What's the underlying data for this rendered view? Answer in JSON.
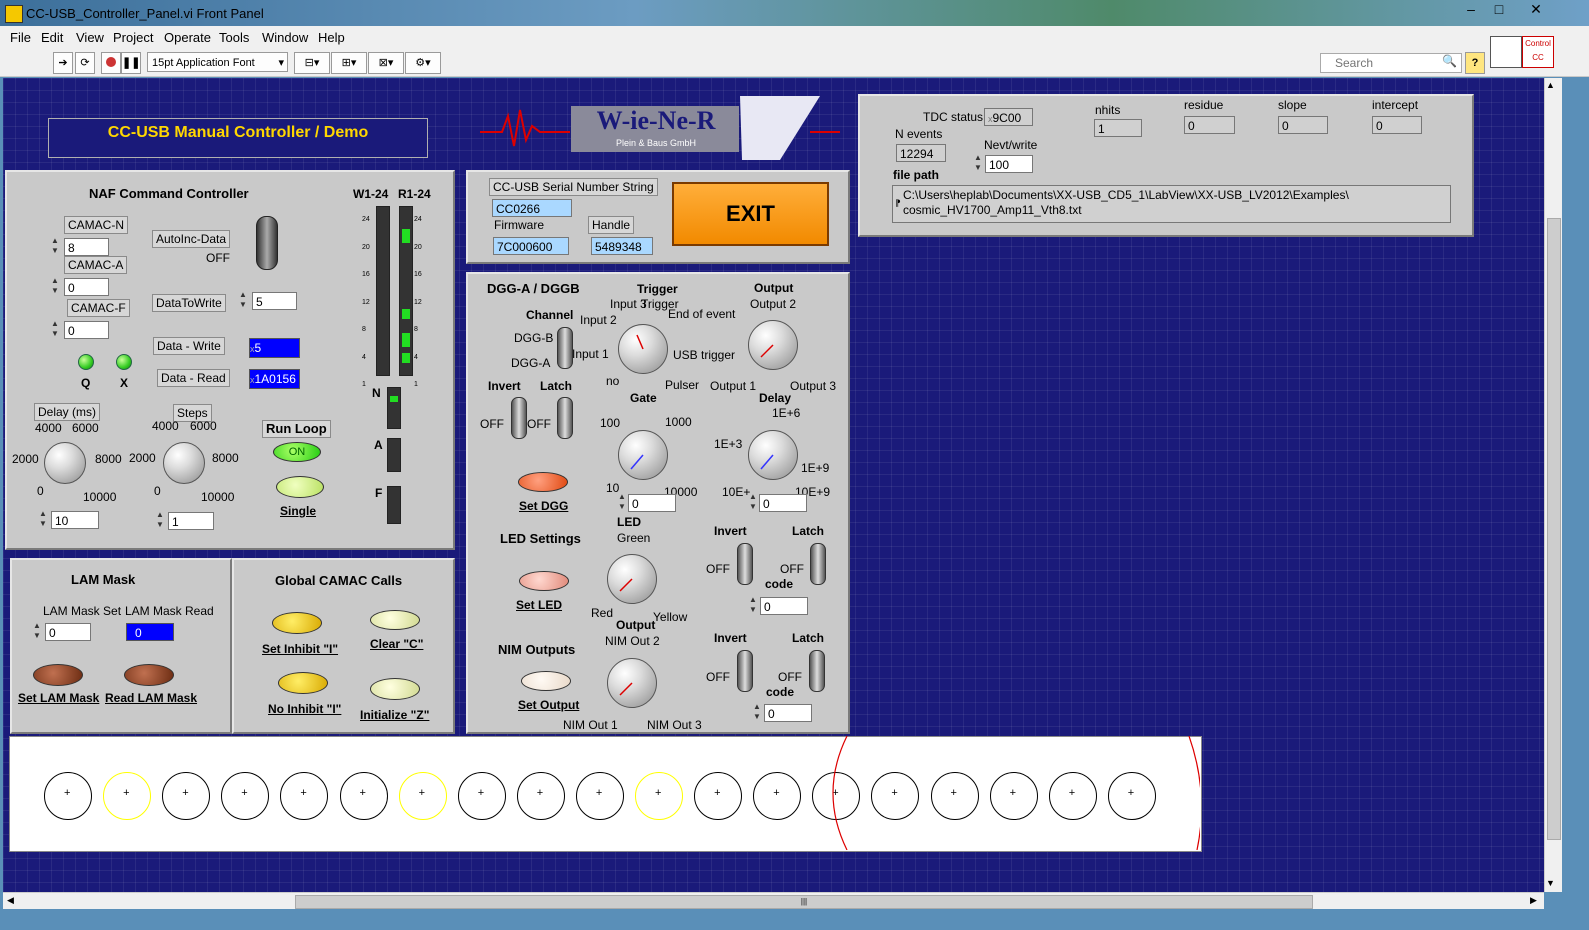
{
  "window": {
    "title": "CC-USB_Controller_Panel.vi Front Panel",
    "minimize": "–",
    "maximize": "□",
    "close": "✕"
  },
  "menu": [
    "File",
    "Edit",
    "View",
    "Project",
    "Operate",
    "Tools",
    "Window",
    "Help"
  ],
  "toolbar": {
    "font_select": "15pt Application Font",
    "search_placeholder": "Search",
    "help": "?",
    "connector_label": "Control CC"
  },
  "header": {
    "title": "CC-USB Manual Controller / Demo",
    "logo_name": "W-ie-Ne-R",
    "logo_sub": "Plein & Baus GmbH"
  },
  "naf": {
    "title": "NAF Command Controller",
    "camac_n_label": "CAMAC-N",
    "camac_n": "8",
    "camac_a_label": "CAMAC-A",
    "camac_a": "0",
    "camac_f_label": "CAMAC-F",
    "camac_f": "0",
    "autoinc_label": "AutoInc-Data",
    "autoinc_state": "OFF",
    "datatowrite_label": "DataToWrite",
    "datatowrite": "5",
    "data_write_label": "Data - Write",
    "data_write": "5",
    "data_write_prefix": "x",
    "data_read_label": "Data - Read",
    "data_read": "1A0156",
    "data_read_prefix": "x",
    "q_label": "Q",
    "x_label": "X",
    "w_label": "W1-24",
    "r_label": "R1-24",
    "n_label": "N",
    "a_label": "A",
    "f_label": "F",
    "delay_label": "Delay (ms)",
    "delay_ticks": {
      "t4000": "4000",
      "t6000": "6000",
      "t2000": "2000",
      "t8000": "8000",
      "t0": "0",
      "t10000": "10000"
    },
    "delay_value": "10",
    "steps_label": "Steps",
    "steps_value": "1",
    "run_loop_label": "Run Loop",
    "run_loop_state": "ON",
    "single_label": "Single",
    "bar_ticks": [
      "24",
      "20",
      "16",
      "12",
      "8",
      "4",
      "1"
    ]
  },
  "lam": {
    "title": "LAM Mask",
    "set_label": "LAM Mask Set",
    "set_value": "0",
    "read_label": "LAM Mask Read",
    "read_value": "0",
    "set_button": "Set LAM Mask",
    "read_button": "Read LAM Mask"
  },
  "global": {
    "title": "Global CAMAC Calls",
    "set_inhibit": "Set Inhibit \"I\"",
    "clear": "Clear \"C\"",
    "no_inhibit": "No Inhibit \"I\"",
    "initialize": "Initialize \"Z\""
  },
  "serial": {
    "serial_label": "CC-USB Serial Number String",
    "serial": "CC0266",
    "firmware_label": "Firmware",
    "firmware": "7C000600",
    "handle_label": "Handle",
    "handle": "5489348",
    "exit": "EXIT"
  },
  "dgg": {
    "title": "DGG-A  / DGGB",
    "channel_label": "Channel",
    "dgg_b": "DGG-B",
    "dgg_a": "DGG-A",
    "trigger_label": "Trigger",
    "trig_input3": "Input 3",
    "trig_trigger": "Trigger",
    "trig_input2": "Input 2",
    "trig_end": "End of event",
    "trig_input1": "Input 1",
    "trig_usb": "USB trigger",
    "trig_no": "no",
    "trig_pulser": "Pulser",
    "output_label": "Output",
    "out2": "Output 2",
    "out1": "Output 1",
    "out3": "Output 3",
    "invert_label": "Invert",
    "latch_label": "Latch",
    "invert_off": "OFF",
    "latch_off": "OFF",
    "gate_label": "Gate",
    "gate_100": "100",
    "gate_1000": "1000",
    "gate_10": "10",
    "gate_10000": "10000",
    "gate_value": "0",
    "delay_label": "Delay",
    "delay_1e6": "1E+6",
    "delay_1e3": "1E+3",
    "delay_1e9": "1E+9",
    "delay_10e": "10E+",
    "delay_10e9": "10E+9",
    "delay_value": "0",
    "set_dgg": "Set DGG"
  },
  "led": {
    "title": "LED Settings",
    "led_label": "LED",
    "green": "Green",
    "red": "Red",
    "yellow": "Yellow",
    "invert_label": "Invert",
    "latch_label": "Latch",
    "invert_off": "OFF",
    "latch_off": "OFF",
    "code_label": "code",
    "code_value": "0",
    "set_led": "Set LED"
  },
  "nim": {
    "title": "NIM Outputs",
    "output_label": "Output",
    "out2": "NIM Out 2",
    "out1": "NIM Out 1",
    "out3": "NIM Out 3",
    "invert_label": "Invert",
    "latch_label": "Latch",
    "invert_off": "OFF",
    "latch_off": "OFF",
    "code_label": "code",
    "code_value": "0",
    "set_output": "Set Output"
  },
  "tdc": {
    "status_label": "TDC status",
    "status": "9C00",
    "status_prefix": "x",
    "nhits_label": "nhits",
    "nhits": "1",
    "residue_label": "residue",
    "residue": "0",
    "slope_label": "slope",
    "slope": "0",
    "intercept_label": "intercept",
    "intercept": "0",
    "nevents_label": "N events",
    "nevents": "12294",
    "nevt_label": "Nevt/write",
    "nevt": "100",
    "filepath_label": "file path",
    "filepath_line1": "C:\\Users\\heplab\\Documents\\XX-USB_CD5_1\\LabView\\XX-USB_LV2012\\Examples\\",
    "filepath_line2": "cosmic_HV1700_Amp11_Vth8.txt"
  },
  "tubes": {
    "count": 19,
    "highlighted_color": "#ffff00",
    "highlighted": [
      1,
      6,
      10
    ],
    "marker": "+",
    "track_color": "#dd0000"
  },
  "colors": {
    "panel_bg": "#1a1a7a",
    "exit_orange": "#f28a00",
    "title_yellow": "#ffd700",
    "led_green": "#33cc22",
    "selected_blue": "#0000ff"
  }
}
